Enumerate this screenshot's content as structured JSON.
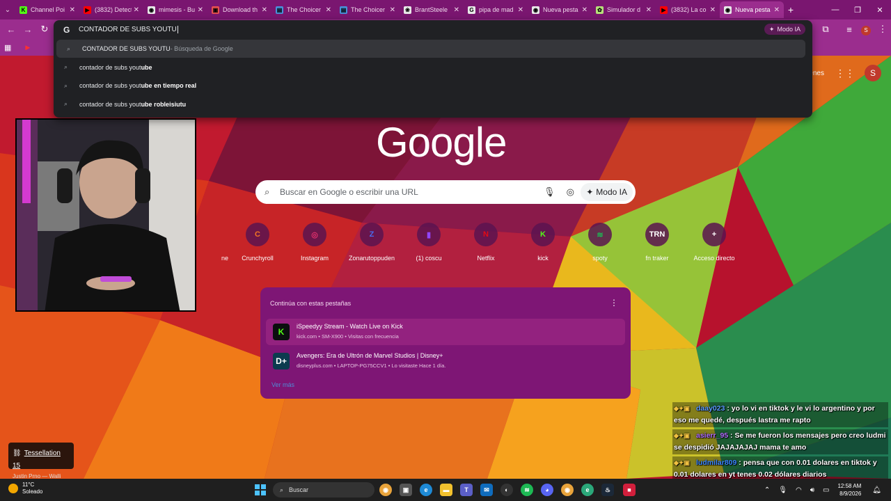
{
  "tabs": [
    {
      "label": "Channel Poi",
      "icon": "kick-icon",
      "color": "#53fc18",
      "glyph": "K"
    },
    {
      "label": "(3832) Detect",
      "icon": "youtube-icon",
      "color": "#ff0000",
      "glyph": "▶"
    },
    {
      "label": "mimesis - Bu",
      "icon": "globe-icon",
      "color": "#e8e8e8",
      "glyph": "◉"
    },
    {
      "label": "Download th",
      "icon": "download-site-icon",
      "color": "#e85050",
      "glyph": "▣"
    },
    {
      "label": "The Choicer",
      "icon": "doc-icon",
      "color": "#4a90d9",
      "glyph": "▤"
    },
    {
      "label": "The Choicer",
      "icon": "doc-icon",
      "color": "#4a90d9",
      "glyph": "▤"
    },
    {
      "label": "BrantSteele",
      "icon": "brantsteele-icon",
      "color": "#e8e8e8",
      "glyph": "❀"
    },
    {
      "label": "pipa de mad",
      "icon": "google-icon",
      "color": "#e8e8e8",
      "glyph": "G"
    },
    {
      "label": "Nueva pesta",
      "icon": "chrome-icon",
      "color": "#e8e8e8",
      "glyph": "◉"
    },
    {
      "label": "Simulador d",
      "icon": "simulator-icon",
      "color": "#b7e07a",
      "glyph": "✿"
    },
    {
      "label": "(3832) La co",
      "icon": "youtube-icon",
      "color": "#ff0000",
      "glyph": "▶"
    },
    {
      "label": "Nueva pesta",
      "icon": "chrome-icon",
      "color": "#e8e8e8",
      "glyph": "◉",
      "active": true
    }
  ],
  "omnibox": {
    "typed": "CONTADOR DE SUBS YOUTU",
    "modo_ia": "Modo IA",
    "suggestions": [
      {
        "prefix": "CONTADOR DE SUBS YOUTU",
        "bold": "",
        "suffix": " - Búsqueda de Google"
      },
      {
        "prefix": "contador de subs yout",
        "bold": "ube",
        "suffix": ""
      },
      {
        "prefix": "contador de subs yout",
        "bold": "ube en tiempo real",
        "suffix": ""
      },
      {
        "prefix": "contador de subs yout",
        "bold": "ube robleisiutu",
        "suffix": ""
      }
    ]
  },
  "ntp": {
    "logo": "Google",
    "search_placeholder": "Buscar en Google o escribir una URL",
    "modo_ia": "Modo IA",
    "images_link": "genes",
    "avatar_letter": "S",
    "shortcuts": [
      {
        "label": "ne",
        "glyph": "",
        "color": "#c04060"
      },
      {
        "label": "Crunchyroll",
        "glyph": "C",
        "color": "#f47521"
      },
      {
        "label": "Instagram",
        "glyph": "◎",
        "color": "#e1306c"
      },
      {
        "label": "Zonarutoppuden",
        "glyph": "Z",
        "color": "#4a6cf0"
      },
      {
        "label": "(1) coscu",
        "glyph": "▮",
        "color": "#9146ff"
      },
      {
        "label": "Netflix",
        "glyph": "N",
        "color": "#e50914"
      },
      {
        "label": "kick",
        "glyph": "K",
        "color": "#53fc18"
      },
      {
        "label": "spoty",
        "glyph": "≋",
        "color": "#1db954"
      },
      {
        "label": "fn traker",
        "glyph": "TRN",
        "color": "#ffffff"
      },
      {
        "label": "Acceso directo",
        "glyph": "+",
        "color": "#ffffff"
      }
    ],
    "continue_card": {
      "title": "Continúa con estas pestañas",
      "items": [
        {
          "title": "iSpeedyy Stream - Watch Live on Kick",
          "sub": "kick.com • SM-X900 • Visitas con frecuencia",
          "glyph": "K",
          "color": "#53fc18",
          "bg": "#0b0e0f"
        },
        {
          "title": "Avengers: Era de Ultrón de Marvel Studios | Disney+",
          "sub": "disneyplus.com • LAPTOP-PG75CCV1 • Lo visitaste Hace 1 día.",
          "glyph": "D+",
          "color": "#ffffff",
          "bg": "#0c3b4f"
        }
      ],
      "more": "Ver más"
    }
  },
  "chat": [
    {
      "user": "daay023",
      "user_color": "#5b9bff",
      "text": " : yo lo vi en tiktok y le vi lo argentino y por eso me quedé, después lastra me rapto"
    },
    {
      "user": "asierr_95",
      "user_color": "#b070ff",
      "text": " : Se me fueron los mensajes pero creo ludmi se despidió JAJAJAJAJ mama te amo"
    },
    {
      "user": "ludmilar809",
      "user_color": "#3a86ff",
      "text": " : pensa que con 0.01 dolares en tiktok y 0.01 dolares en yt tenes 0.02 dólares diarios"
    }
  ],
  "now_playing": {
    "track": "Tessellation 15",
    "artist": "Justin Prno — Walli"
  },
  "taskbar": {
    "weather_temp": "11°C",
    "weather_desc": "Soleado",
    "search": "Buscar",
    "time": "12:58 AM",
    "date": "8/9/2026"
  }
}
